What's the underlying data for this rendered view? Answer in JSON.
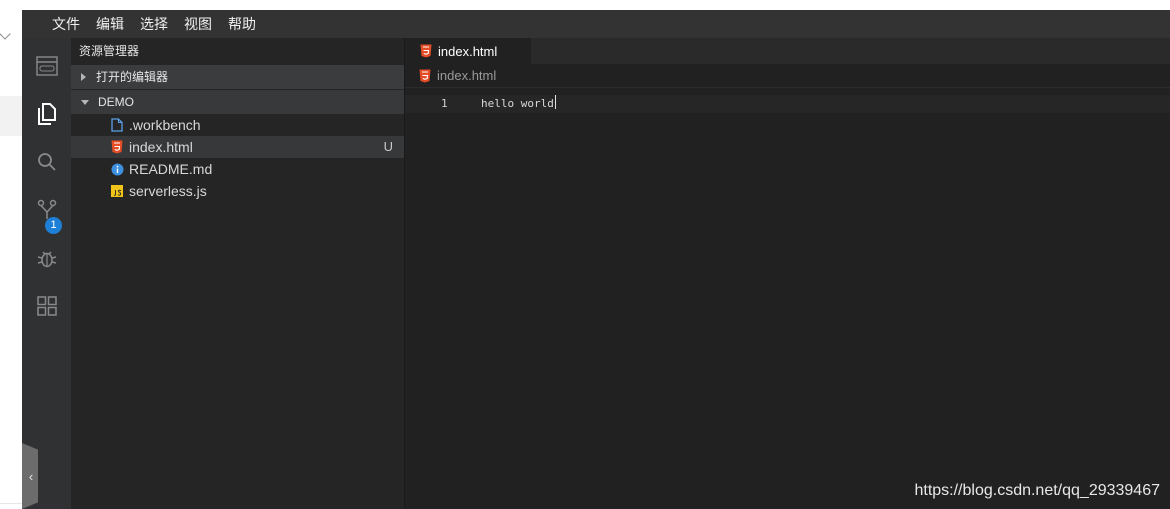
{
  "menubar": {
    "items": [
      "文件",
      "编辑",
      "选择",
      "视图",
      "帮助"
    ]
  },
  "activitybar": {
    "icons": [
      "browser-preview-icon",
      "files-icon",
      "search-icon",
      "source-control-icon",
      "debug-icon",
      "extensions-icon"
    ],
    "scm_badge": "1",
    "collapse_glyph": "‹"
  },
  "sidebar": {
    "title": "资源管理器",
    "open_editors_label": "打开的编辑器",
    "folder_label": "DEMO",
    "files": [
      {
        "name": ".workbench",
        "icon": "file-outline-icon",
        "status": ""
      },
      {
        "name": "index.html",
        "icon": "html5-icon",
        "status": "U"
      },
      {
        "name": "README.md",
        "icon": "info-icon",
        "status": ""
      },
      {
        "name": "serverless.js",
        "icon": "js-icon",
        "status": ""
      }
    ]
  },
  "editor": {
    "tab_label": "index.html",
    "breadcrumb": "index.html",
    "line_number": "1",
    "line_text": "hello world"
  },
  "colors": {
    "background": "#212121",
    "menubar": "#333333",
    "activitybar": "#2f3133",
    "sidebar": "#252526",
    "html_icon": "#e44d26",
    "info_icon": "#3d8fe0",
    "js_icon": "#f0c419",
    "badge": "#1e7fd6"
  },
  "watermark": "https://blog.csdn.net/qq_29339467"
}
